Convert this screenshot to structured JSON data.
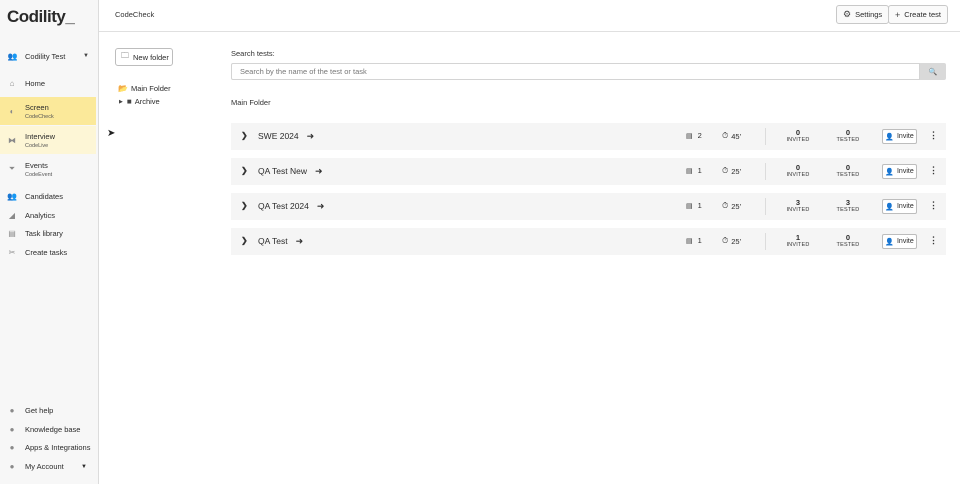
{
  "app": {
    "logo_text": "Codility",
    "logo_cursor": "_"
  },
  "sidebar": {
    "org_name": "Codility Test",
    "nav": [
      {
        "label": "Home",
        "sub": "",
        "icon": "home-icon"
      },
      {
        "label": "Screen",
        "sub": "CodeCheck",
        "icon": "screen-icon"
      },
      {
        "label": "Interview",
        "sub": "CodeLive",
        "icon": "interview-icon"
      },
      {
        "label": "Events",
        "sub": "CodeEvent",
        "icon": "events-icon"
      },
      {
        "label": "Candidates",
        "sub": "",
        "icon": "candidates-icon"
      },
      {
        "label": "Analytics",
        "sub": "",
        "icon": "analytics-icon"
      },
      {
        "label": "Task library",
        "sub": "",
        "icon": "task-library-icon"
      },
      {
        "label": "Create tasks",
        "sub": "",
        "icon": "create-tasks-icon"
      }
    ],
    "footer": [
      {
        "label": "Get help",
        "icon": "help-icon"
      },
      {
        "label": "Knowledge base",
        "icon": "knowledge-base-icon"
      },
      {
        "label": "Apps & Integrations",
        "icon": "apps-icon"
      },
      {
        "label": "My Account",
        "icon": "account-icon"
      }
    ]
  },
  "topbar": {
    "breadcrumb": "CodeCheck",
    "settings_label": "Settings",
    "create_test_label": "Create test"
  },
  "folders": {
    "new_folder_label": "New folder",
    "main_folder": "Main Folder",
    "archive": "Archive"
  },
  "search": {
    "label": "Search tests:",
    "placeholder": "Search by the name of the test or task"
  },
  "section_title": "Main Folder",
  "tests": [
    {
      "name": "SWE 2024",
      "tasks": "2",
      "time": "45'",
      "invited": "0",
      "tested": "0"
    },
    {
      "name": "QA Test New",
      "tasks": "1",
      "time": "25'",
      "invited": "0",
      "tested": "0"
    },
    {
      "name": "QA Test 2024",
      "tasks": "1",
      "time": "25'",
      "invited": "3",
      "tested": "3"
    },
    {
      "name": "QA Test",
      "tasks": "1",
      "time": "25'",
      "invited": "1",
      "tested": "0"
    }
  ],
  "labels": {
    "invited": "INVITED",
    "tested": "TESTED",
    "invite": "Invite"
  },
  "colors": {
    "active_nav": "#fbe99a",
    "soft_nav": "#fdf6d6",
    "row_bg": "#f5f5f5"
  }
}
